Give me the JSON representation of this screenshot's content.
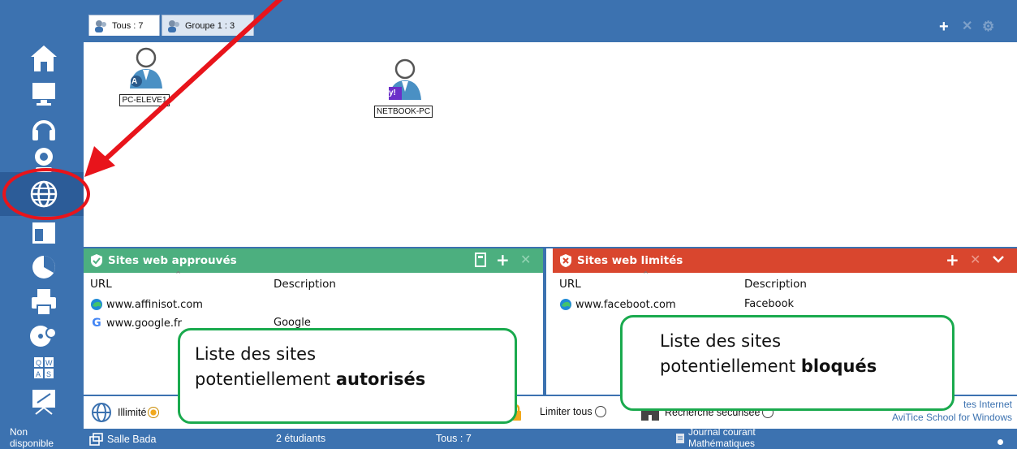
{
  "tabs": [
    {
      "label": "Tous : 7"
    },
    {
      "label": "Groupe 1 : 3"
    }
  ],
  "top_actions": {
    "add": "+",
    "remove": "✕",
    "settings": "⚙"
  },
  "clients": [
    {
      "name": "PC-ELEVE1",
      "badge": "A"
    },
    {
      "name": "NETBOOK-PC",
      "badge": "y!"
    }
  ],
  "approved": {
    "title": "Sites web approuvés",
    "col_url": "URL",
    "col_desc": "Description",
    "rows": [
      {
        "url": "www.affinisot.com",
        "description": ""
      },
      {
        "url": "www.google.fr",
        "description": "Google"
      }
    ],
    "color": "#4caf7f"
  },
  "limited": {
    "title": "Sites web limités",
    "col_url": "URL",
    "col_desc": "Description",
    "rows": [
      {
        "url": "www.faceboot.com",
        "description": "Facebook"
      }
    ],
    "color": "#d9462e"
  },
  "controls": {
    "unlimited": "Illimité",
    "limit_all": "Limiter tous",
    "secure_search": "Recherche sécurisée",
    "brand_line1": "tes Internet",
    "brand_line2": "AviTice School for Windows"
  },
  "status": {
    "availability_1": "Non",
    "availability_2": "disponible",
    "room": "Salle Bada",
    "students": "2 étudiants",
    "all": "Tous : 7",
    "journal_1": "Journal courant",
    "journal_2": "Mathématiques"
  },
  "callouts": {
    "left_line1": "Liste des sites",
    "left_line2": "potentiellement ",
    "left_bold": "autorisés",
    "right_line1": "Liste des sites",
    "right_line2": "potentiellement ",
    "right_bold": "bloqués"
  },
  "accent": "#3c72b0",
  "callout_color": "#1aaa4e",
  "arrow_color": "#e8141b"
}
